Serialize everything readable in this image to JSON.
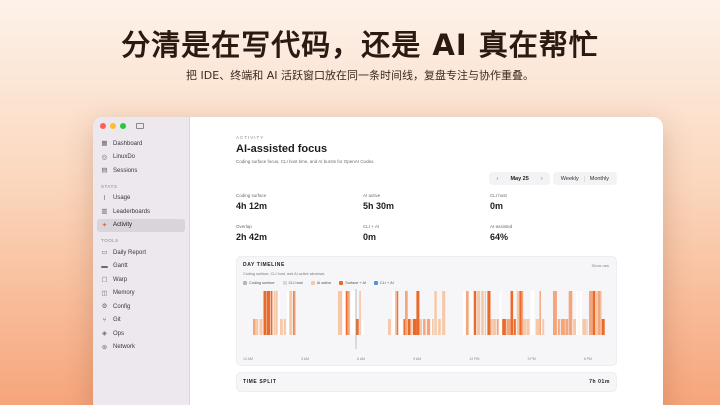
{
  "hero": {
    "title": "分清是在写代码，还是 AI 真在帮忙",
    "subtitle": "把 IDE、终端和 AI 活跃窗口放在同一条时间线，复盘专注与协作重叠。"
  },
  "sidebar": {
    "items": [
      {
        "label": "Dashboard",
        "icon": "dashboard-icon",
        "glyph": "▦"
      },
      {
        "label": "LinuxDo",
        "icon": "linuxdo-icon",
        "glyph": "◎"
      },
      {
        "label": "Sessions",
        "icon": "sessions-icon",
        "glyph": "▤"
      }
    ],
    "stats_label": "STATS",
    "stats_items": [
      {
        "label": "Usage",
        "icon": "usage-icon",
        "glyph": "⌇"
      },
      {
        "label": "Leaderboards",
        "icon": "leaderboards-icon",
        "glyph": "▥"
      },
      {
        "label": "Activity",
        "icon": "activity-icon",
        "glyph": "✦",
        "active": true
      }
    ],
    "tools_label": "TOOLS",
    "tools_items": [
      {
        "label": "Daily Report",
        "icon": "daily-report-icon",
        "glyph": "▭"
      },
      {
        "label": "Gantt",
        "icon": "gantt-icon",
        "glyph": "▬"
      },
      {
        "label": "Warp",
        "icon": "warp-icon",
        "glyph": "▢"
      },
      {
        "label": "Memory",
        "icon": "memory-icon",
        "glyph": "◫"
      },
      {
        "label": "Config",
        "icon": "config-icon",
        "glyph": "⚙"
      },
      {
        "label": "Git",
        "icon": "git-icon",
        "glyph": "⑂"
      },
      {
        "label": "Ops",
        "icon": "ops-icon",
        "glyph": "◈"
      },
      {
        "label": "Network",
        "icon": "network-icon",
        "glyph": "⊛"
      }
    ]
  },
  "main": {
    "eyebrow": "ACTIVITY",
    "title": "AI-assisted focus",
    "description": "Coding surface focus, CLI host time, and AI bursts for OpenAI Codex.",
    "date": "May 25",
    "prev": "‹",
    "next": "›",
    "range": [
      "Weekly",
      "Monthly"
    ],
    "stats": [
      {
        "label": "Coding surface",
        "value": "4h 12m"
      },
      {
        "label": "AI active",
        "value": "5h 30m"
      },
      {
        "label": "CLI host",
        "value": "0m"
      },
      {
        "label": "Overlap",
        "value": "2h 42m"
      },
      {
        "label": "CLI + AI",
        "value": "0m"
      },
      {
        "label": "AI-assisted",
        "value": "64%"
      }
    ]
  },
  "timeline_card": {
    "title": "DAY TIMELINE",
    "action": "Show raw",
    "description": "Coding surface, CLI host, and AI active windows.",
    "legend": [
      {
        "label": "Coding surface",
        "color": "#b9b5bd"
      },
      {
        "label": "CLI host",
        "color": "#d9d6dc"
      },
      {
        "label": "AI active",
        "color": "#f7c8a8"
      },
      {
        "label": "Surface + AI",
        "color": "#ea6a2c"
      },
      {
        "label": "CLI + AI",
        "color": "#5b8fd6"
      }
    ],
    "ticks": [
      "12 AM",
      "3 AM",
      "6 AM",
      "9 AM",
      "12 PM",
      "3 PM",
      "6 PM"
    ]
  },
  "split_card": {
    "title": "TIME SPLIT",
    "value": "7h 01m"
  }
}
